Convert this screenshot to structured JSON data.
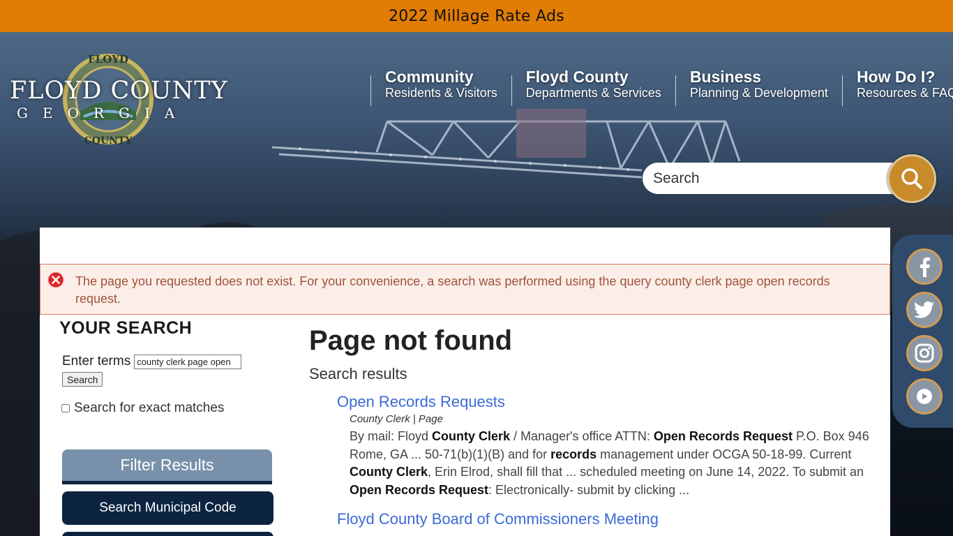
{
  "banner": {
    "text": "2022 Millage Rate Ads"
  },
  "logo": {
    "name": "FLOYD COUNTY",
    "sub": "GEORGIA",
    "seal_top": "FLOYD",
    "seal_bottom": "COUNTY"
  },
  "nav": [
    {
      "title": "Community",
      "sub": "Residents & Visitors"
    },
    {
      "title": "Floyd County",
      "sub": "Departments & Services"
    },
    {
      "title": "Business",
      "sub": "Planning & Development"
    },
    {
      "title": "How Do I?",
      "sub": "Resources & FAQs"
    }
  ],
  "search": {
    "placeholder": "Search"
  },
  "alert": {
    "text": "The page you requested does not exist. For your convenience, a search was performed using the query county clerk page open records request."
  },
  "left": {
    "heading": "YOUR SEARCH",
    "enter_label": "Enter terms",
    "enter_value": "county clerk page open",
    "search_button": "Search",
    "exact_label": "Search for exact matches",
    "filter_label": "Filter Results",
    "municipal_label": "Search Municipal Code"
  },
  "main": {
    "title": "Page not found",
    "results_label": "Search results",
    "results": [
      {
        "title": "Open Records Requests",
        "meta": "County Clerk | Page",
        "s1": "By mail: Floyd ",
        "b1": "County Clerk",
        "s2": " / Manager's office ATTN: ",
        "b2": "Open Records Request",
        "s3": " P.O. Box 946 Rome, GA ... 50-71(b)(1)(B) and for ",
        "b3": "records",
        "s4": " management under OCGA 50-18-99. Current ",
        "b4": "County Clerk",
        "s5": ", Erin Elrod, shall fill that ... scheduled meeting on June 14, 2022. To submit an ",
        "b5": "Open Records Request",
        "s6": ":   Electronically- submit by clicking ..."
      },
      {
        "title": "Floyd County Board of Commissioners Meeting"
      }
    ]
  },
  "colors": {
    "banner": "#e17c05",
    "navy": "#0c2440",
    "link": "#3b6ad6",
    "search_button": "#c98a2b"
  }
}
